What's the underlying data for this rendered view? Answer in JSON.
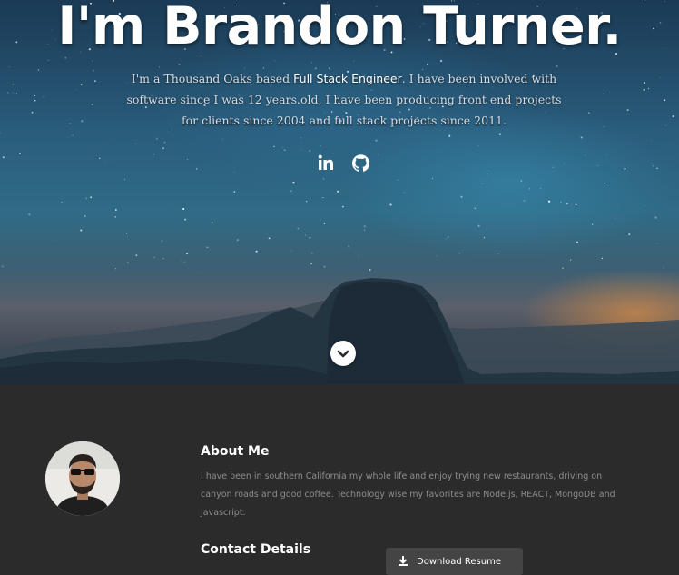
{
  "hero": {
    "title": "I'm Brandon Turner.",
    "intro_before": "I'm a Thousand Oaks based ",
    "intro_highlight": "Full Stack Engineer",
    "intro_after": ". I have been involved with software since I was 12 years old, I have been producing front end projects for clients since 2004 and full stack projects since 2011.",
    "social": [
      {
        "icon": "linkedin-icon"
      },
      {
        "icon": "github-icon"
      }
    ],
    "scroll_icon": "chevron-down-icon"
  },
  "about": {
    "heading": "About Me",
    "body": "I have been in southern California my whole life and enjoy trying new restaurants, driving on canyon roads and good coffee. Technology wise my favorites are Node.js, REACT, MongoDB and Javascript.",
    "contact_heading": "Contact Details",
    "resume_button": "Download Resume",
    "resume_icon": "download-icon"
  },
  "colors": {
    "about_bg": "#2b2b2b",
    "button_bg": "#444444",
    "body_text": "#8d8d8d"
  }
}
